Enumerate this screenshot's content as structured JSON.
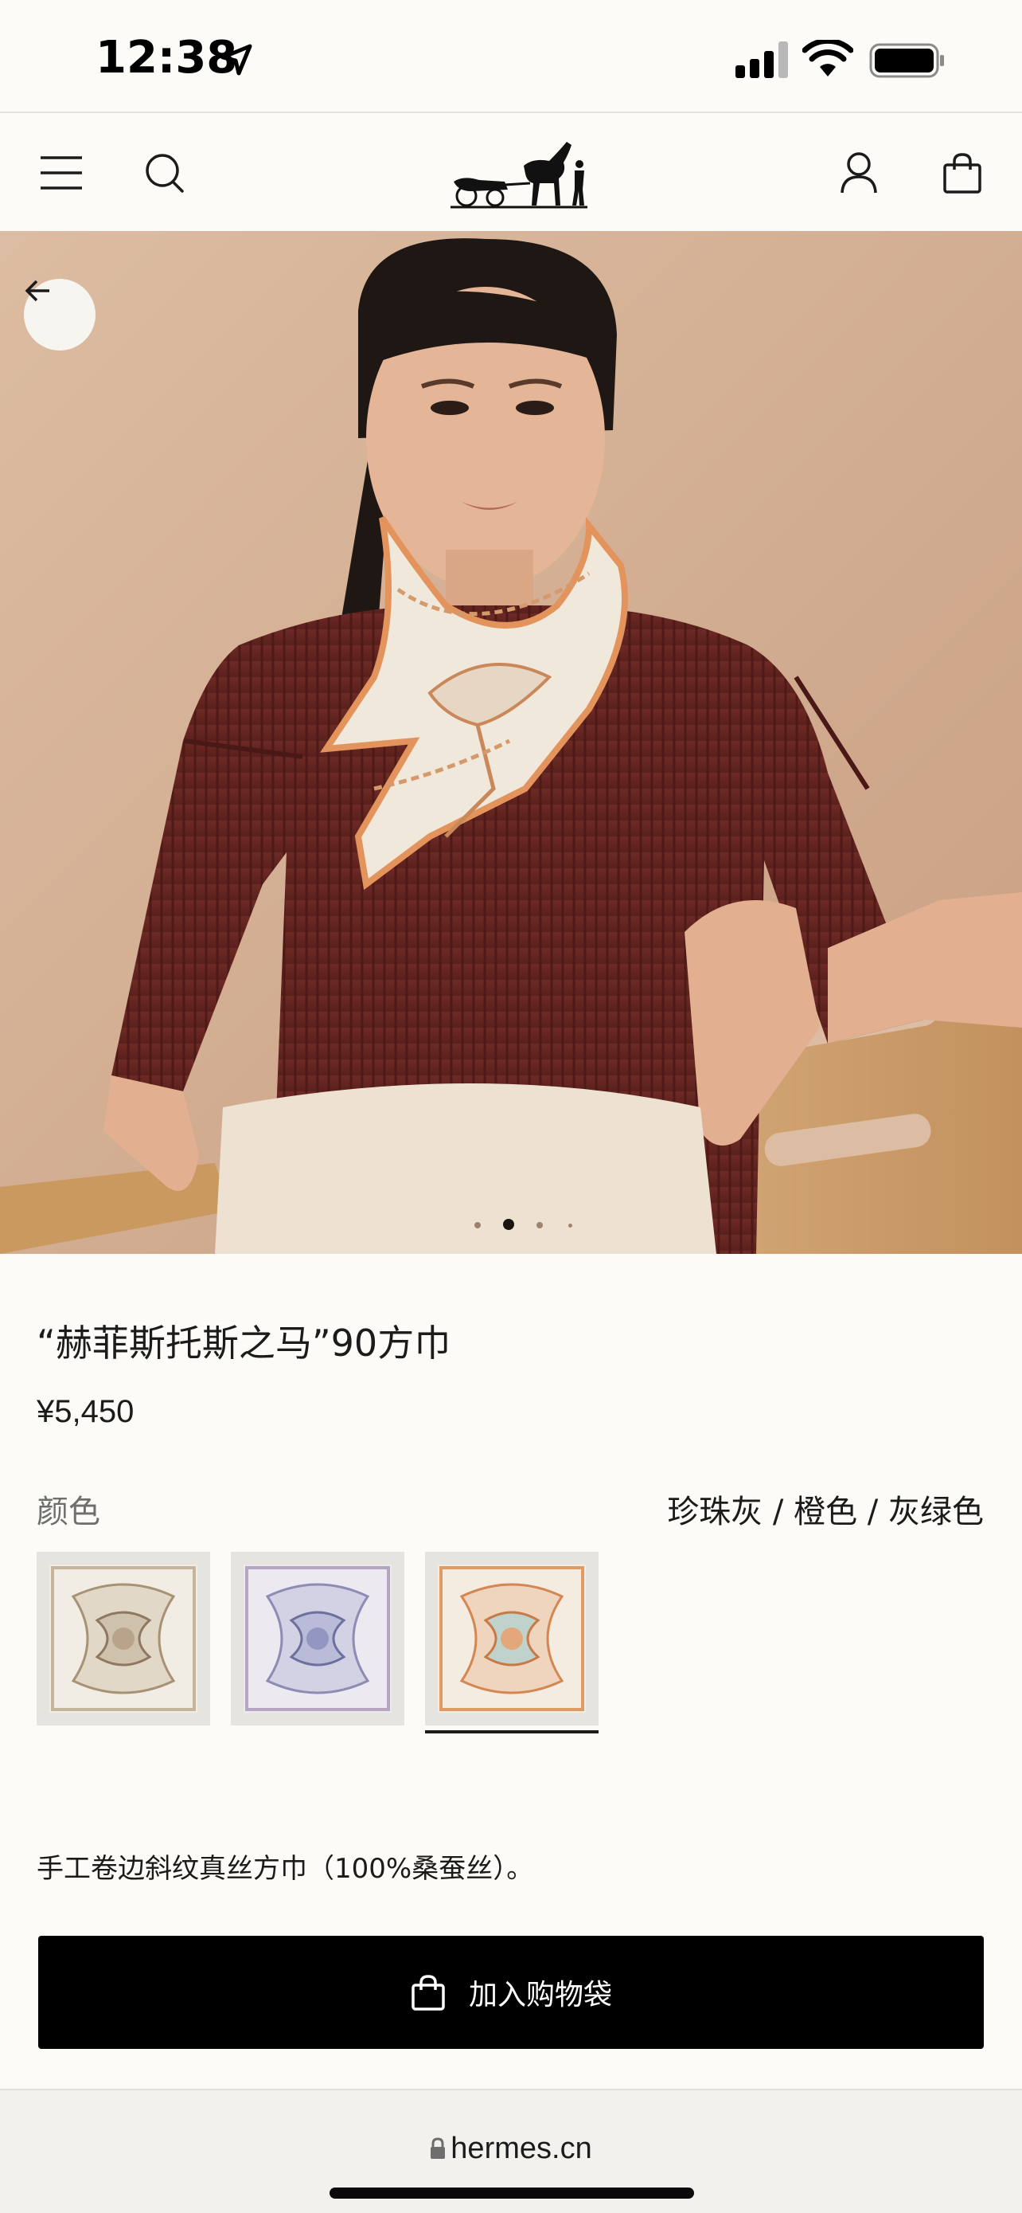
{
  "status_bar": {
    "time": "12:38"
  },
  "header": {
    "icons": [
      "menu-icon",
      "search-icon",
      "hermes-logo",
      "account-icon",
      "shopping-bag-icon"
    ]
  },
  "gallery": {
    "slide_count": 4,
    "active_slide": 2
  },
  "product": {
    "title": "“赫菲斯托斯之马”90方巾",
    "price": "¥5,450",
    "color_label": "颜色",
    "selected_colors": "珍珠灰 / 橙色 / 灰绿色",
    "swatch_count": 3,
    "selected_swatch": 3,
    "description": "手工卷边斜纹真丝方巾（100%桑蚕丝）。",
    "add_to_bag_label": "加入购物袋"
  },
  "browser": {
    "url": "hermes.cn"
  },
  "colors": {
    "background": "#fcfbf7",
    "button": "#000000",
    "text": "#1b1b1b",
    "muted_text": "#6e6e6e"
  }
}
